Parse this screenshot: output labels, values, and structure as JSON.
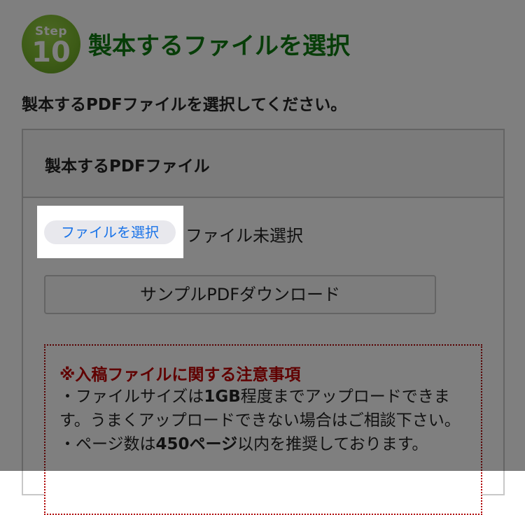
{
  "step": {
    "badge_word": "Step",
    "badge_number": "10",
    "title": "製本するファイルを選択"
  },
  "instruction": "製本するPDFファイルを選択してください。",
  "card": {
    "header_label": "製本するPDFファイル",
    "file_select_button": "ファイルを選択",
    "file_status": "ファイル未選択",
    "sample_button": "サンプルPDFダウンロード"
  },
  "notice": {
    "title": "※入稿ファイルに関する注意事項",
    "line1_prefix": "・ファイルサイズは",
    "line1_bold": "1GB",
    "line1_suffix": "程度までアップロードできます。うまくアップロードできない場合はご相談下さい。",
    "line2_prefix": "・ページ数は",
    "line2_bold": "450ページ",
    "line2_suffix": "以内を推奨しております。"
  },
  "colors": {
    "badge_green": "#7cb82e",
    "title_green": "#0f7a10",
    "notice_red": "#c00000",
    "link_blue": "#1a73e8",
    "dim_overlay": "rgba(0,0,0,0.5)"
  }
}
